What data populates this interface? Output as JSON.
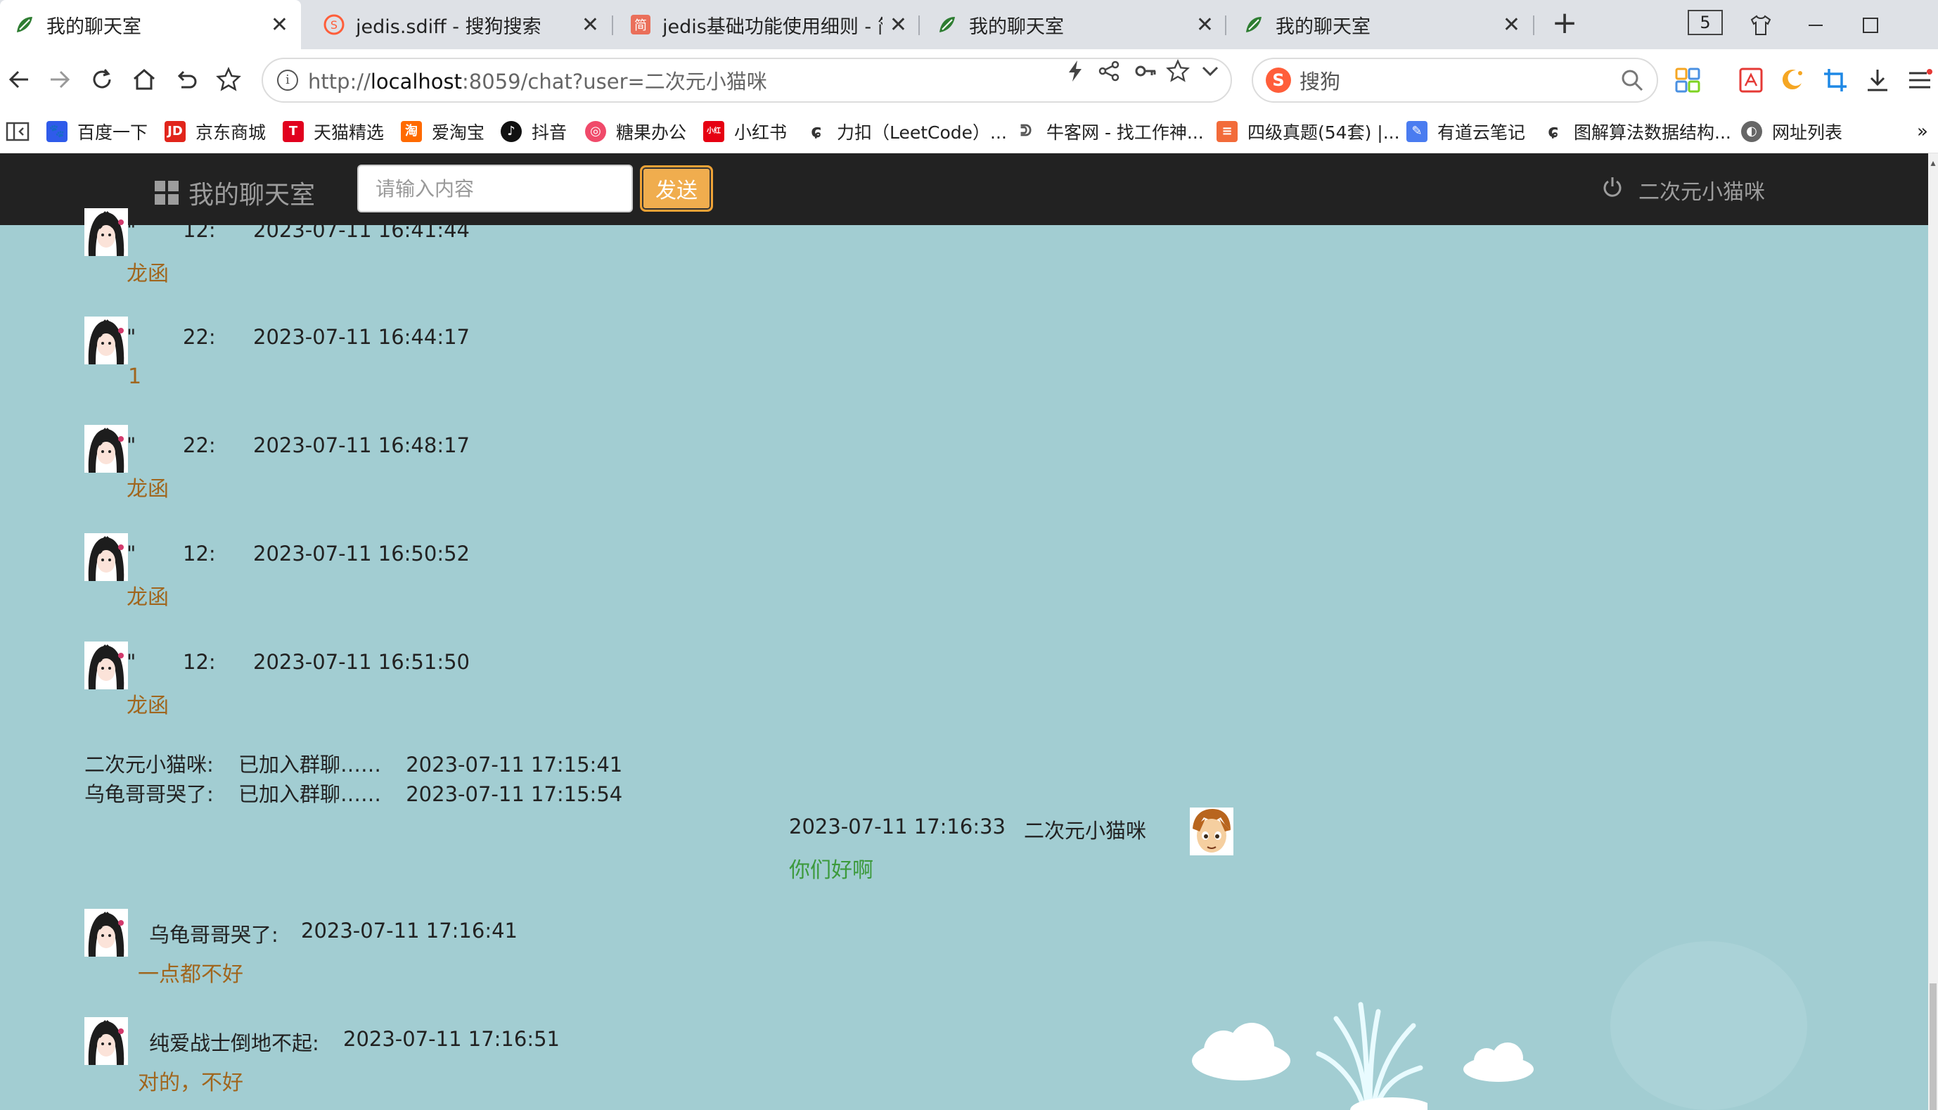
{
  "browser": {
    "tabs": [
      {
        "title": "我的聊天室",
        "active": true,
        "favicon": "chat-leaf-icon"
      },
      {
        "title": "jedis.sdiff - 搜狗搜索",
        "active": false,
        "favicon": "sogou-icon"
      },
      {
        "title": "jedis基础功能使用细则 - 简书",
        "active": false,
        "favicon": "jianshu-icon"
      },
      {
        "title": "我的聊天室",
        "active": false,
        "favicon": "chat-leaf-icon"
      },
      {
        "title": "我的聊天室",
        "active": false,
        "favicon": "chat-leaf-icon"
      }
    ],
    "tab_count": "5",
    "url_prefix": "http://",
    "url_host": "localhost",
    "url_rest": ":8059/chat?user=二次元小猫咪",
    "search_placeholder": "搜狗",
    "bookmarks": [
      {
        "label": "百度一下",
        "icon": "baidu-icon",
        "color": "#2f5bea"
      },
      {
        "label": "京东商城",
        "icon": "jd-icon",
        "color": "#e1251b"
      },
      {
        "label": "天猫精选",
        "icon": "tmall-icon",
        "color": "#e1001e"
      },
      {
        "label": "爱淘宝",
        "icon": "taobao-icon",
        "color": "#ff6a00"
      },
      {
        "label": "抖音",
        "icon": "douyin-icon",
        "color": "#111111"
      },
      {
        "label": "糖果办公",
        "icon": "candy-icon",
        "color": "#f04a6a"
      },
      {
        "label": "小红书",
        "icon": "xiaohongshu-icon",
        "color": "#e60012"
      },
      {
        "label": "力扣（LeetCode）...",
        "icon": "leetcode-icon",
        "color": "#333333"
      },
      {
        "label": "牛客网 - 找工作神...",
        "icon": "nowcoder-icon",
        "color": "#555555"
      },
      {
        "label": "四级真题(54套) |...",
        "icon": "doc-icon",
        "color": "#f26b3a"
      },
      {
        "label": "有道云笔记",
        "icon": "youdao-icon",
        "color": "#4a7cf0"
      },
      {
        "label": "图解算法数据结构...",
        "icon": "leetcode-icon",
        "color": "#333333"
      },
      {
        "label": "网址列表",
        "icon": "globe-icon",
        "color": "#666666"
      }
    ]
  },
  "app": {
    "brand": "我的聊天室",
    "input_placeholder": "请输入内容",
    "send_label": "发送",
    "current_user": "二次元小猫咪"
  },
  "chat": {
    "messages": [
      {
        "sender": "12:",
        "time": "2023-07-11 16:41:44",
        "text": "龙函"
      },
      {
        "sender": "22:",
        "time": "2023-07-11 16:44:17",
        "text": "1"
      },
      {
        "sender": "22:",
        "time": "2023-07-11 16:48:17",
        "text": "龙函"
      },
      {
        "sender": "12:",
        "time": "2023-07-11 16:50:52",
        "text": "龙函"
      },
      {
        "sender": "12:",
        "time": "2023-07-11 16:51:50",
        "text": "龙函"
      }
    ],
    "quote_mark": "\"",
    "system": [
      {
        "user": "二次元小猫咪:",
        "action": "已加入群聊……",
        "time": "2023-07-11 17:15:41"
      },
      {
        "user": "乌龟哥哥哭了:",
        "action": "已加入群聊……",
        "time": "2023-07-11 17:15:54"
      }
    ],
    "self_message": {
      "time": "2023-07-11 17:16:33",
      "user": "二次元小猫咪",
      "text": "你们好啊"
    },
    "later_messages": [
      {
        "sender": "乌龟哥哥哭了:",
        "time": "2023-07-11 17:16:41",
        "text": "一点都不好"
      },
      {
        "sender": "纯爱战士倒地不起:",
        "time": "2023-07-11 17:16:51",
        "text": "对的，不好"
      }
    ]
  },
  "colors": {
    "page_bg": "#a2cdd2",
    "navbar_bg": "#222222",
    "send_btn": "#f0ad4e",
    "message_text": "#a0661e",
    "self_message_text": "#3c9a3c"
  }
}
